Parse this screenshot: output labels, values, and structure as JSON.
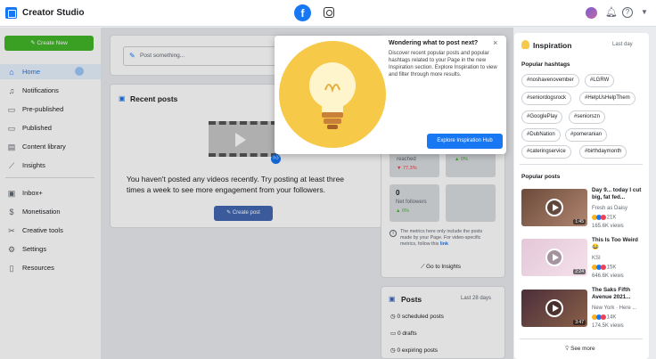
{
  "app": {
    "title": "Creator Studio"
  },
  "sidebar": {
    "create_label": "Create New",
    "items": [
      {
        "label": "Home",
        "icon": "home-icon"
      },
      {
        "label": "Notifications",
        "icon": "bell-icon"
      },
      {
        "label": "Pre-published",
        "icon": "document-icon"
      },
      {
        "label": "Published",
        "icon": "document-icon"
      },
      {
        "label": "Content library",
        "icon": "library-icon"
      },
      {
        "label": "Insights",
        "icon": "chart-line-icon"
      },
      {
        "label": "Inbox+",
        "icon": "inbox-icon"
      },
      {
        "label": "Monetisation",
        "icon": "dollar-icon"
      },
      {
        "label": "Creative tools",
        "icon": "tools-icon"
      },
      {
        "label": "Settings",
        "icon": "gear-icon"
      },
      {
        "label": "Resources",
        "icon": "resources-icon"
      }
    ]
  },
  "composer": {
    "placeholder": "Post something..."
  },
  "recent_posts": {
    "title": "Recent posts",
    "empty_message": "You haven't posted any videos recently. Try posting at least three times a week to see more engagement from your followers.",
    "create_post_label": "Create post"
  },
  "insights": {
    "reached_label": "reached",
    "reached_change": "77.3%",
    "other_change": "0%",
    "net_followers_value": "0",
    "net_followers_label": "Net followers",
    "net_followers_change": "0%",
    "note": "The metrics here only include the posts made by your Page. For video-specific metrics, follow this",
    "note_link": "link",
    "go_label": "Go to Insights"
  },
  "posts_summary": {
    "title": "Posts",
    "range": "Last 28 days",
    "rows": [
      "0 scheduled posts",
      "0 drafts",
      "0 expiring posts"
    ]
  },
  "popup": {
    "title": "Wondering what to post next?",
    "description": "Discover recent popular posts and popular hashtags related to your Page in the new Inspiration section. Explore Inspiration to view and filter through more results.",
    "button_label": "Explore Inspiration Hub",
    "close": "×"
  },
  "inspiration": {
    "title": "Inspiration",
    "range": "Last day",
    "hashtags_title": "Popular hashtags",
    "hashtags": [
      "#noshavenovember",
      "#LGRW",
      "#seniordogsrock",
      "#HelpUsHelpThem",
      "#GooglePlay",
      "#seniorszn",
      "#DubNation",
      "#pomeranian",
      "#cateringservice",
      "#birthdaymonth"
    ],
    "posts_title": "Popular posts",
    "posts": [
      {
        "title": "Day 9... today I cut big, fat fed...",
        "author": "Fresh as Daisy",
        "reactions": "21K",
        "views": "165.6K views",
        "duration": "1:45"
      },
      {
        "title": "This Is Too Weird 😂",
        "author": "KSI",
        "reactions": "15K",
        "views": "646.6K views",
        "duration": "2:24"
      },
      {
        "title": "The Saks Fifth Avenue 2021...",
        "author": "New York · Here ...",
        "reactions": "14K",
        "views": "174.5K views",
        "duration": "3:47"
      }
    ],
    "see_more": "See more"
  }
}
